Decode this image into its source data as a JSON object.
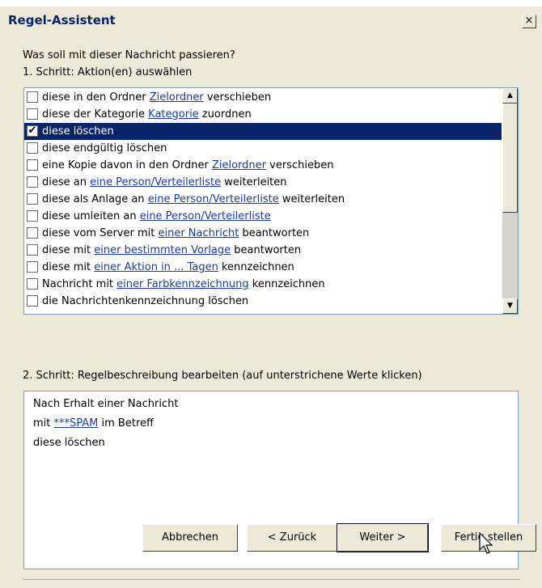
{
  "dialog": {
    "title": "Regel-Assistent",
    "close_glyph": "×",
    "question": "Was soll mit dieser Nachricht passieren?",
    "step1_label": "1. Schritt: Aktion(en) auswählen",
    "step2_label": "2. Schritt: Regelbeschreibung bearbeiten (auf unterstrichene Werte klicken)"
  },
  "actions": [
    {
      "pre": "diese in den Ordner ",
      "link": "Zielordner",
      "post": " verschieben",
      "checked": false,
      "selected": false
    },
    {
      "pre": "diese der Kategorie ",
      "link": "Kategorie",
      "post": " zuordnen",
      "checked": false,
      "selected": false
    },
    {
      "pre": "diese löschen",
      "link": "",
      "post": "",
      "checked": true,
      "selected": true
    },
    {
      "pre": "diese endgültig löschen",
      "link": "",
      "post": "",
      "checked": false,
      "selected": false
    },
    {
      "pre": "eine Kopie davon in den Ordner ",
      "link": "Zielordner",
      "post": " verschieben",
      "checked": false,
      "selected": false
    },
    {
      "pre": "diese an ",
      "link": "eine Person/Verteilerliste",
      "post": " weiterleiten",
      "checked": false,
      "selected": false
    },
    {
      "pre": "diese als Anlage an ",
      "link": "eine Person/Verteilerliste",
      "post": " weiterleiten",
      "checked": false,
      "selected": false
    },
    {
      "pre": "diese umleiten an ",
      "link": "eine Person/Verteilerliste",
      "post": "",
      "checked": false,
      "selected": false
    },
    {
      "pre": "diese vom Server mit ",
      "link": "einer Nachricht",
      "post": " beantworten",
      "checked": false,
      "selected": false
    },
    {
      "pre": "diese mit ",
      "link": "einer bestimmten Vorlage",
      "post": " beantworten",
      "checked": false,
      "selected": false
    },
    {
      "pre": "diese mit ",
      "link": "einer Aktion in ... Tagen",
      "post": " kennzeichnen",
      "checked": false,
      "selected": false
    },
    {
      "pre": "Nachricht mit ",
      "link": "einer Farbkennzeichnung",
      "post": " kennzeichnen",
      "checked": false,
      "selected": false
    },
    {
      "pre": "die Nachrichtenkennzeichnung löschen",
      "link": "",
      "post": "",
      "checked": false,
      "selected": false
    }
  ],
  "scrollbar": {
    "up_glyph": "▲",
    "down_glyph": "▼"
  },
  "description": {
    "line1": "Nach Erhalt einer Nachricht",
    "line2_pre": "mit ",
    "line2_link": "***SPAM",
    "line2_post": " im Betreff",
    "line3": "diese löschen"
  },
  "buttons": {
    "cancel": "Abbrechen",
    "back": "< Zurück",
    "next": "Weiter >",
    "finish": "Fertig stellen"
  },
  "colors": {
    "selection": "#0a246a",
    "link": "#1a3da6",
    "dialog_bg": "#ece9d8"
  }
}
